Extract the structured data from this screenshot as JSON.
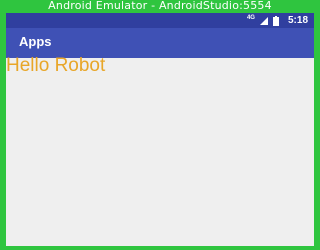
{
  "window": {
    "title": "Android Emulator - AndroidStudio:5554"
  },
  "status_bar": {
    "network_type": "4G",
    "signal_icon": "cell-signal-icon",
    "battery_icon": "battery-icon",
    "time": "5:18"
  },
  "app_bar": {
    "title": "Apps"
  },
  "content": {
    "text": "Hello Robot"
  },
  "colors": {
    "window_frame": "#2fc53f",
    "status_bar": "#303f9f",
    "app_bar": "#3f51b5",
    "background": "#efefef",
    "text_accent": "#e8a628"
  }
}
